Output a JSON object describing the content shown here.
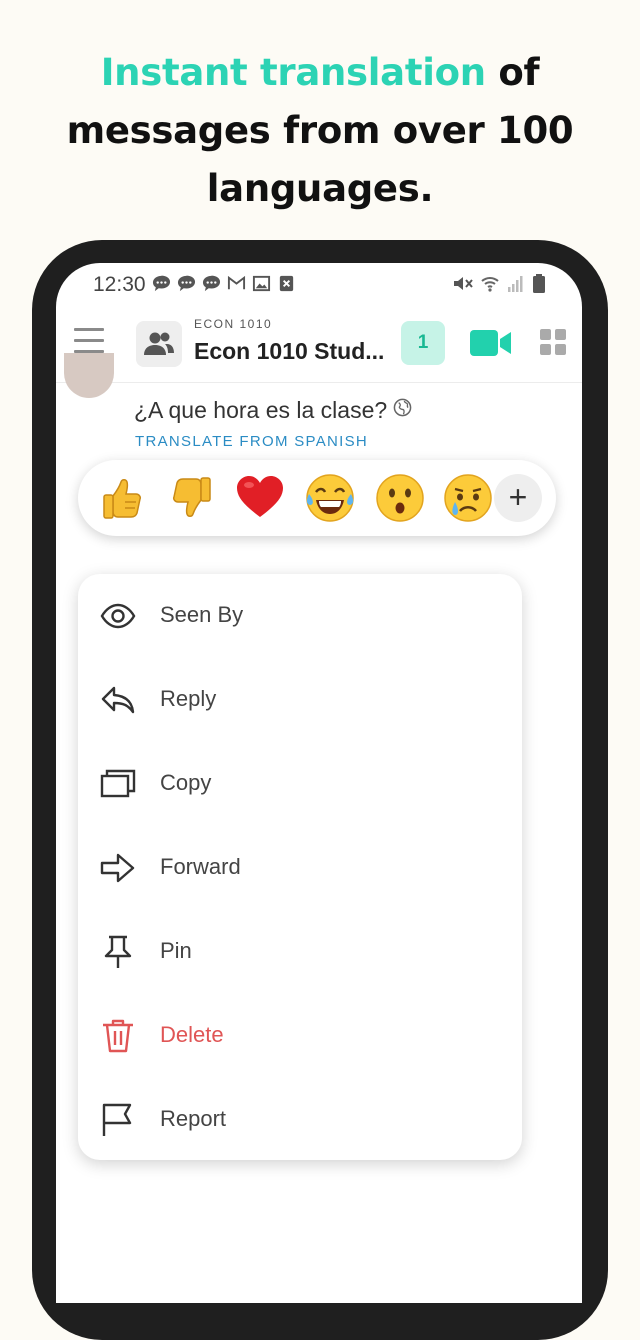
{
  "promo": {
    "headline_accent": "Instant translation",
    "headline_line1_rest": "of",
    "headline_line2": "messages from over 100",
    "headline_line3": "languages."
  },
  "status_bar": {
    "time": "12:30",
    "notification_icons": [
      "chat-bubble-icon",
      "chat-bubble-icon",
      "chat-bubble-icon",
      "gmail-icon",
      "image-icon",
      "close-box-icon"
    ],
    "system_icons": [
      "mute-vibrate-icon",
      "wifi-icon",
      "signal-icon",
      "battery-icon"
    ]
  },
  "header": {
    "course_code": "ECON 1010",
    "title": "Econ 1010 Stud...",
    "badge_count": "1"
  },
  "message": {
    "text": "¿A que hora es la clase?",
    "translate_label": "TRANSLATE FROM SPANISH"
  },
  "reactions": {
    "items": [
      {
        "name": "thumbs-up",
        "glyph": "👍"
      },
      {
        "name": "thumbs-down",
        "glyph": "👎"
      },
      {
        "name": "heart",
        "glyph": "❤️"
      },
      {
        "name": "tears-of-joy",
        "glyph": "😂"
      },
      {
        "name": "surprised",
        "glyph": "😮"
      },
      {
        "name": "crying",
        "glyph": "😢"
      }
    ],
    "add_label": "+"
  },
  "menu": {
    "items": [
      {
        "label": "Seen By",
        "icon": "eye-icon"
      },
      {
        "label": "Reply",
        "icon": "reply-icon"
      },
      {
        "label": "Copy",
        "icon": "copy-icon"
      },
      {
        "label": "Forward",
        "icon": "forward-icon"
      },
      {
        "label": "Pin",
        "icon": "pin-icon"
      },
      {
        "label": "Delete",
        "icon": "trash-icon"
      },
      {
        "label": "Report",
        "icon": "flag-icon"
      }
    ]
  },
  "colors": {
    "accent": "#2cd3b4",
    "background": "#fdfbf5",
    "phone_frame": "#1f1f1f",
    "badge_bg": "#c6f3e7",
    "video": "#22d1ad",
    "link": "#2b8cc4",
    "danger": "#e05555"
  }
}
